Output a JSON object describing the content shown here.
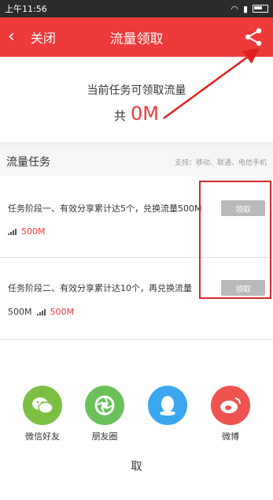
{
  "status_bar": {
    "time": "上午11:56"
  },
  "header": {
    "back_label": "关闭",
    "title": "流量领取"
  },
  "summary": {
    "line1": "当前任务可领取流量",
    "prefix": "共",
    "amount": "0M"
  },
  "section": {
    "title": "流量任务",
    "support_note": "支持：移动、联通、电信手机"
  },
  "tasks": [
    {
      "desc": "任务阶段一、有效分享累计达5个，兑换流量500M",
      "value": "500M",
      "button": "领取"
    },
    {
      "desc": "任务阶段二、有效分享累计达10个，再兑换流量",
      "prefix": "500M",
      "value": "500M",
      "button": "领取"
    }
  ],
  "share_targets": [
    {
      "label": "微信好友",
      "icon": "wechat-icon",
      "color": "#7bc043"
    },
    {
      "label": "朋友圈",
      "icon": "moments-icon",
      "color": "#6cc05a"
    },
    {
      "label": "",
      "icon": "qq-icon",
      "color": "#3aa7f0"
    },
    {
      "label": "微博",
      "icon": "weibo-icon",
      "color": "#ef5350"
    }
  ],
  "cancel_label": "取",
  "colors": {
    "accent": "#ee3a3a",
    "button_gray": "#b9b9b9"
  }
}
